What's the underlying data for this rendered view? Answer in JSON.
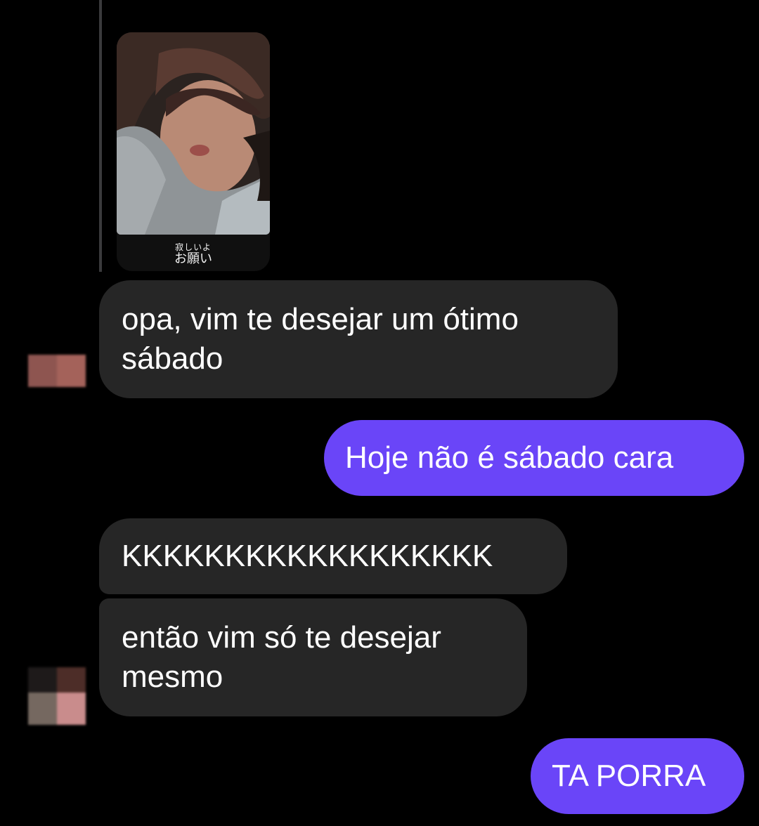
{
  "story_reply": {
    "caption_ruby": "寂しいよ",
    "caption_main": "お願い"
  },
  "messages": [
    {
      "sender": "them",
      "lines": [
        "opa, vim te desejar um ótimo",
        "sábado"
      ]
    },
    {
      "sender": "me",
      "lines": [
        "Hoje não é sábado cara"
      ]
    },
    {
      "sender": "them",
      "lines": [
        "KKKKKKKKKKKKKKKKKK"
      ]
    },
    {
      "sender": "them",
      "lines": [
        "então vim só te desejar",
        "mesmo"
      ]
    },
    {
      "sender": "me",
      "lines": [
        "TA PORRA"
      ]
    }
  ],
  "colors": {
    "background": "#000000",
    "incoming_bubble": "#262626",
    "outgoing_bubble": "#6a45f8",
    "text": "#ffffff"
  }
}
